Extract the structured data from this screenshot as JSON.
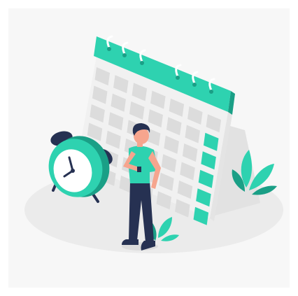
{
  "illustration": {
    "subject": "calendar-scheduling",
    "elements": [
      "calendar",
      "alarm-clock",
      "man-checking-watch",
      "plants"
    ],
    "colors": {
      "accent": "#2ed2b0",
      "accent_dark": "#1a9f86",
      "calendar_face": "#f1f1f1",
      "calendar_side": "#e2e2e2",
      "cell": "#dcdcdc",
      "ground": "#ebebeb",
      "skin": "#f6a58e",
      "pants": "#263152",
      "hair": "#263152",
      "clock_body": "#2ed2b0",
      "clock_face": "#ffffff",
      "dark": "#263152"
    }
  }
}
